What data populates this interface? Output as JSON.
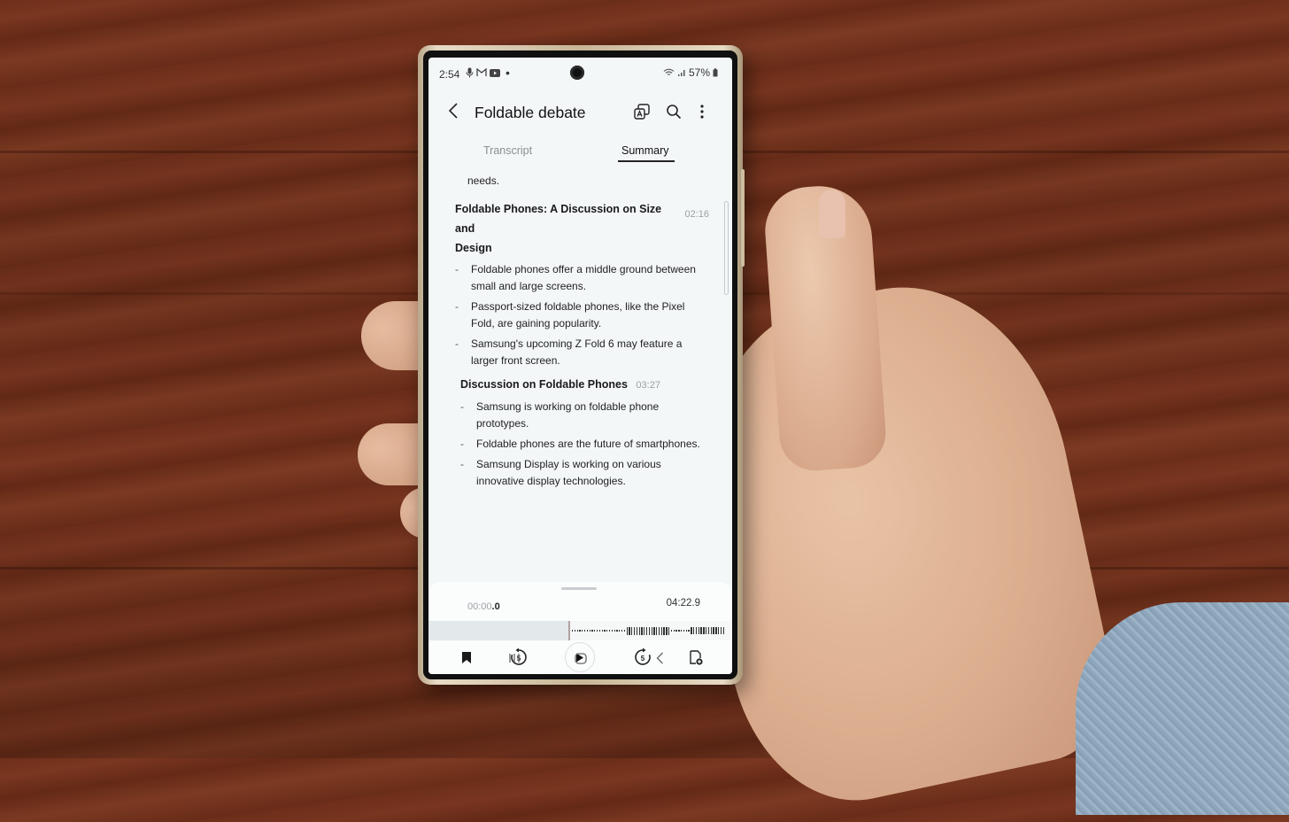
{
  "status_bar": {
    "time": "2:54",
    "left_icons": [
      "microphone-icon",
      "gmail-icon",
      "youtube-icon",
      "dot-icon"
    ],
    "right_icons": [
      "wifi-icon",
      "signal-icon"
    ],
    "battery": "57%"
  },
  "app_bar": {
    "title": "Foldable debate",
    "actions": [
      "translate-icon",
      "search-icon",
      "more-options-icon"
    ]
  },
  "tabs": [
    {
      "label": "Transcript",
      "active": false
    },
    {
      "label": "Summary",
      "active": true
    }
  ],
  "summary": {
    "leading_text": "needs.",
    "sections": [
      {
        "title": "Foldable Phones: A Discussion on Size and Design",
        "title_line1": "Foldable Phones: A Discussion on Size and",
        "title_line2": "Design",
        "timestamp": "02:16",
        "bullets": [
          "Foldable phones offer a middle ground between small and large screens.",
          "Passport-sized foldable phones, like the Pixel Fold, are gaining popularity.",
          "Samsung's upcoming Z Fold 6 may feature a larger front screen."
        ]
      },
      {
        "title": "Discussion on Foldable Phones",
        "timestamp": "03:27",
        "bullets": [
          "Samsung is working on foldable phone prototypes.",
          "Foldable phones are the future of smartphones.",
          "Samsung Display is working on various innovative display technologies."
        ]
      }
    ]
  },
  "player": {
    "current_time_main": "00:00",
    "current_time_fraction": ".0",
    "total_time": "04:22.9",
    "playback_progress": 0,
    "controls": [
      "bookmark-icon",
      "rewind-5-icon",
      "play-icon",
      "forward-5-icon",
      "add-note-icon"
    ],
    "rewind_seconds": "5",
    "forward_seconds": "5"
  },
  "nav_bar": [
    "recent-apps-button",
    "home-button",
    "back-button"
  ],
  "colors": {
    "screen_bg": "#f4f7f8",
    "accent_text": "#111111",
    "muted_text": "#9aa0a5"
  }
}
